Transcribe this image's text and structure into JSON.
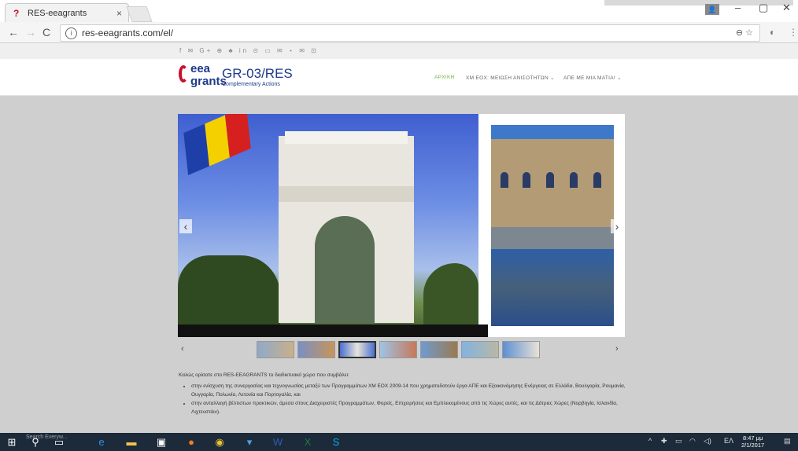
{
  "browser": {
    "tab_title": "RES-eeagrants",
    "tab_close": "×",
    "url": "res-eeagrants.com/el/",
    "window_controls": {
      "minimize": "–",
      "maximize": "▢",
      "close": "✕"
    }
  },
  "site": {
    "social_icons": "f ✉ G+ ⊕ ♣ in ⊙ ▭ ✉ ⋆ ✉ ⊡",
    "logo": {
      "line1": "eea",
      "line2": "grants"
    },
    "brand_title": "GR-03/RES",
    "brand_subtitle": "Complementary Actions",
    "menu": [
      {
        "label": "ΑΡΧΙΚΗ",
        "active": true
      },
      {
        "label": "ΧΜ ΕΟΧ: ΜΕΙΩΣΗ ΑΝΙΣΟΤΗΤΩΝ ⌄",
        "active": false
      },
      {
        "label": "ΑΠΕ ΜΕ ΜΙΑ ΜΑΤΙΑ! ⌄",
        "active": false
      }
    ],
    "slider": {
      "prev": "‹",
      "next": "›",
      "thumb_count": 7,
      "active_thumb": 2
    },
    "thumb_nav": {
      "prev": "‹",
      "next": "›"
    },
    "intro_text": "Καλώς ορίσατε στο RES-EEAGRANTS το διαδικτυακό χώρο που συμβάλει:",
    "bullets": [
      "στην ενίσχυση της συνεργασίας και τεχνογνωσίας μεταξύ των Προγραμμάτων ΧΜ ΕΟΧ 2009-14 που χρηματοδοτούν έργα ΑΠΕ και Εξοικονόμησης Ενέργειας σε Ελλάδα, Βουλγαρία, Ρουμανία, Ουγγαρία, Πολωνία, Λετονία και Πορτογαλία, και",
      "στην ανταλλαγή βέλτιστων πρακτικών, άμεσα στους Διαχειριστές Προγραμμάτων, Φορείς, Επιχειρήσεις και Εμπλεκομένους από τις Χώρες αυτές, και τις Δότριες Χώρες (Νορβηγία, Ισλανδία, Λιχτενστάιν)."
    ]
  },
  "taskbar": {
    "search_hint": "Search Everyw...",
    "lang": "ΕΛ",
    "time": "8:47 μμ",
    "date": "2/1/2017"
  },
  "colors": {
    "brand_blue": "#1f3a8a",
    "accent_green": "#6cb33f",
    "logo_red": "#c8102e",
    "page_gray": "#cfcfcf",
    "taskbar": "#1c2a3a"
  }
}
